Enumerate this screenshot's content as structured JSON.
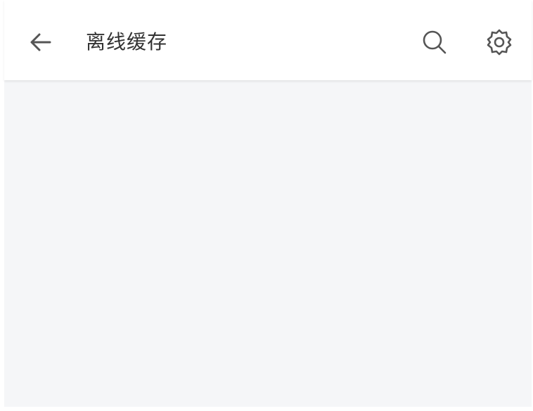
{
  "header": {
    "title": "离线缓存",
    "back_icon": "arrow-left-icon",
    "search_icon": "search-icon",
    "settings_icon": "gear-icon"
  },
  "colors": {
    "header_bg": "#ffffff",
    "content_bg": "#f5f6f8",
    "icon": "#555555",
    "title_text": "#333333"
  },
  "main": {
    "items": []
  }
}
